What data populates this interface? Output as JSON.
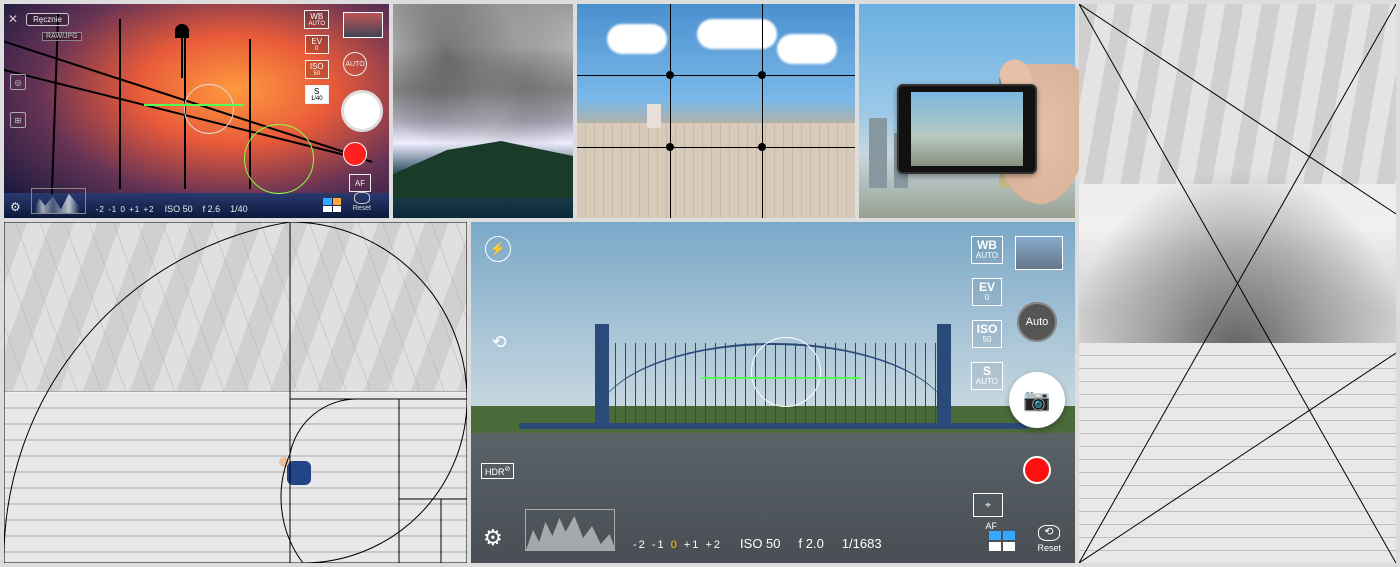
{
  "camera1": {
    "mode_button": "Ręcznie",
    "format": "RAW/JPG",
    "wb": {
      "label": "WB",
      "value": "AUTO"
    },
    "ev": {
      "label": "EV",
      "value": "0"
    },
    "iso_chip": {
      "label": "ISO",
      "value": "50"
    },
    "s_chip": {
      "label": "S",
      "value": "1/40"
    },
    "mode_circle": "AUTO",
    "af": "AF",
    "reset": "Reset",
    "ev_scale": "-2  -1  0  +1  +2",
    "iso": "ISO 50",
    "aperture": "f 2.6",
    "shutter": "1/40"
  },
  "camera2": {
    "wb": {
      "label": "WB",
      "value": "AUTO"
    },
    "ev": {
      "label": "EV",
      "value": "0"
    },
    "iso_chip": {
      "label": "ISO",
      "value": "50"
    },
    "s_chip": {
      "label": "S",
      "value": "AUTO"
    },
    "mode_circle": "Auto",
    "hdr": "HDR",
    "af": "AF",
    "reset": "Reset",
    "ev_scale_neg2": "-2",
    "ev_scale_neg1": "-1",
    "ev_scale_zero": "0",
    "ev_scale_pos1": "+1",
    "ev_scale_pos2": "+2",
    "iso": "ISO 50",
    "aperture": "f 2.0",
    "shutter": "1/1683"
  }
}
